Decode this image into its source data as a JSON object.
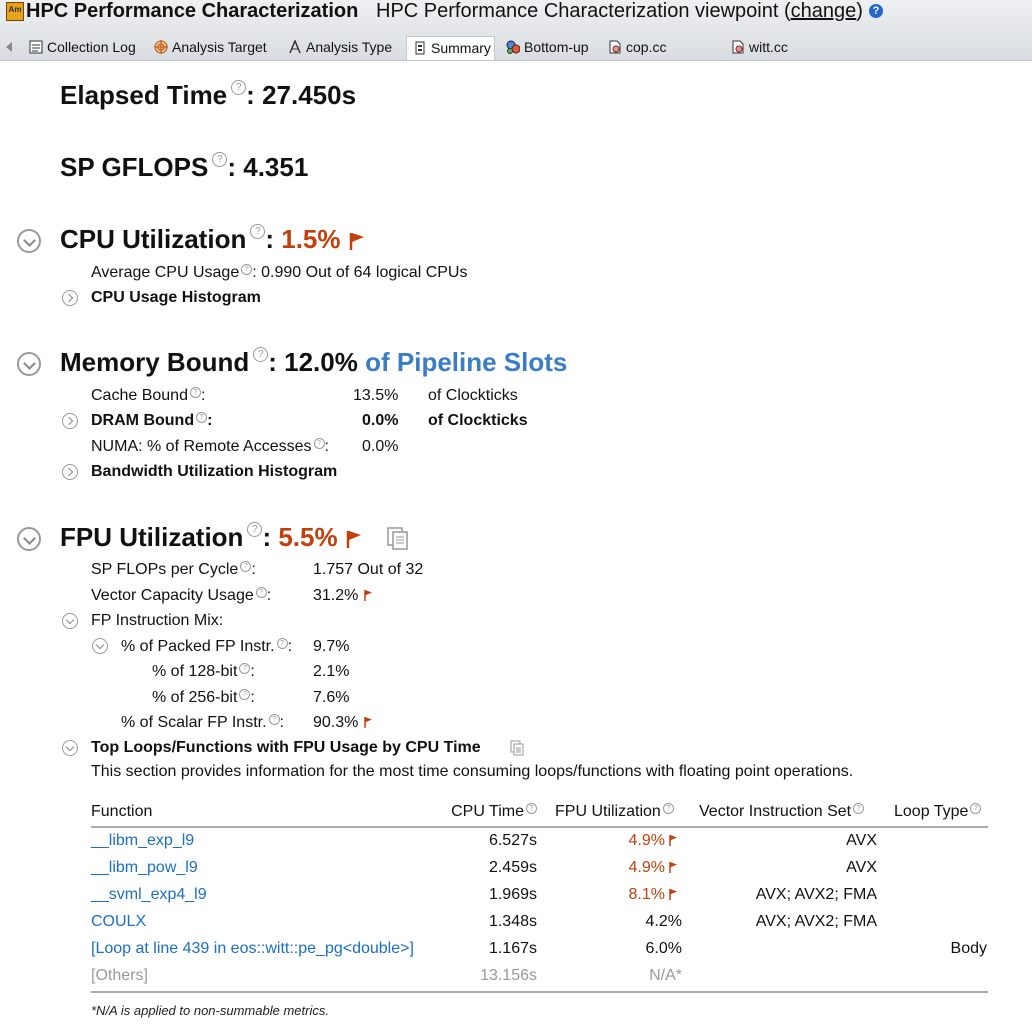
{
  "header": {
    "app_title": "HPC Performance Characterization",
    "viewpoint_prefix": "HPC Performance Characterization viewpoint (",
    "viewpoint_change": "change",
    "viewpoint_suffix": ")",
    "app_icon_text": "Am",
    "help_glyph": "?"
  },
  "tabs": [
    {
      "label": "Collection Log",
      "icon": "collection-log-icon"
    },
    {
      "label": "Analysis Target",
      "icon": "target-icon"
    },
    {
      "label": "Analysis Type",
      "icon": "analysis-type-icon"
    },
    {
      "label": "Summary",
      "icon": "summary-icon",
      "active": true
    },
    {
      "label": "Bottom-up",
      "icon": "bottom-up-icon"
    },
    {
      "label": "cop.cc",
      "icon": "source-file-icon"
    },
    {
      "label": "witt.cc",
      "icon": "source-file-icon"
    }
  ],
  "summary": {
    "elapsed_label": "Elapsed Time",
    "elapsed_value": "27.450s",
    "gflops_label": "SP GFLOPS",
    "gflops_value": "4.351",
    "sep": ":"
  },
  "cpu": {
    "label": "CPU Utilization",
    "value": "1.5%",
    "avg_label": "Average CPU Usage",
    "avg_value": "0.990 Out of 64 logical CPUs",
    "histogram_label": "CPU Usage Histogram"
  },
  "memory": {
    "label": "Memory Bound",
    "value": "12.0%",
    "unit": "of Pipeline Slots",
    "cache_label": "Cache Bound",
    "cache_value": "13.5%",
    "cache_unit": "of Clockticks",
    "dram_label": "DRAM Bound",
    "dram_value": "0.0%",
    "dram_unit": "of Clockticks",
    "numa_label": "NUMA: % of Remote Accesses",
    "numa_value": "0.0%",
    "bandwidth_label": "Bandwidth Utilization Histogram"
  },
  "fpu": {
    "label": "FPU Utilization",
    "value": "5.5%",
    "sp_flops_label": "SP FLOPs per Cycle",
    "sp_flops_value": "1.757 Out of 32",
    "vector_label": "Vector Capacity Usage",
    "vector_value": "31.2%",
    "mix_label": "FP Instruction Mix:",
    "packed_label": "% of Packed FP Instr.",
    "packed_value": "9.7%",
    "b128_label": "% of 128-bit",
    "b128_value": "2.1%",
    "b256_label": "% of 256-bit",
    "b256_value": "7.6%",
    "scalar_label": "% of Scalar FP Instr.",
    "scalar_value": "90.3%",
    "top_loops_label": "Top Loops/Functions with FPU Usage by CPU Time",
    "top_loops_desc": "This section provides information for the most time consuming loops/functions with floating point operations."
  },
  "table": {
    "headers": [
      "Function",
      "CPU Time",
      "FPU Utilization",
      "Vector Instruction Set",
      "Loop Type"
    ],
    "rows": [
      {
        "function": "__libm_exp_l9",
        "cpu_time": "6.527s",
        "fpu": "4.9%",
        "fpu_flag": true,
        "vis": "AVX",
        "loop_type": ""
      },
      {
        "function": "__libm_pow_l9",
        "cpu_time": "2.459s",
        "fpu": "4.9%",
        "fpu_flag": true,
        "vis": "AVX",
        "loop_type": ""
      },
      {
        "function": "__svml_exp4_l9",
        "cpu_time": "1.969s",
        "fpu": "8.1%",
        "fpu_flag": true,
        "vis": "AVX; AVX2; FMA",
        "loop_type": ""
      },
      {
        "function": "COULX",
        "cpu_time": "1.348s",
        "fpu": "4.2%",
        "fpu_flag": false,
        "vis": "AVX; AVX2; FMA",
        "loop_type": ""
      },
      {
        "function": "[Loop at line 439 in eos::witt::pe_pg<double>]",
        "cpu_time": "1.167s",
        "fpu": "6.0%",
        "fpu_flag": false,
        "vis": "",
        "loop_type": "Body"
      },
      {
        "function": "[Others]",
        "cpu_time": "13.156s",
        "fpu": "N/A*",
        "fpu_flag": false,
        "vis": "",
        "loop_type": "",
        "muted": true
      }
    ],
    "footnote": "*N/A is applied to non-summable metrics."
  },
  "colors": {
    "flag": "#c0410d",
    "link": "#1a6fbf",
    "accent_blue": "#3a7dc4"
  }
}
